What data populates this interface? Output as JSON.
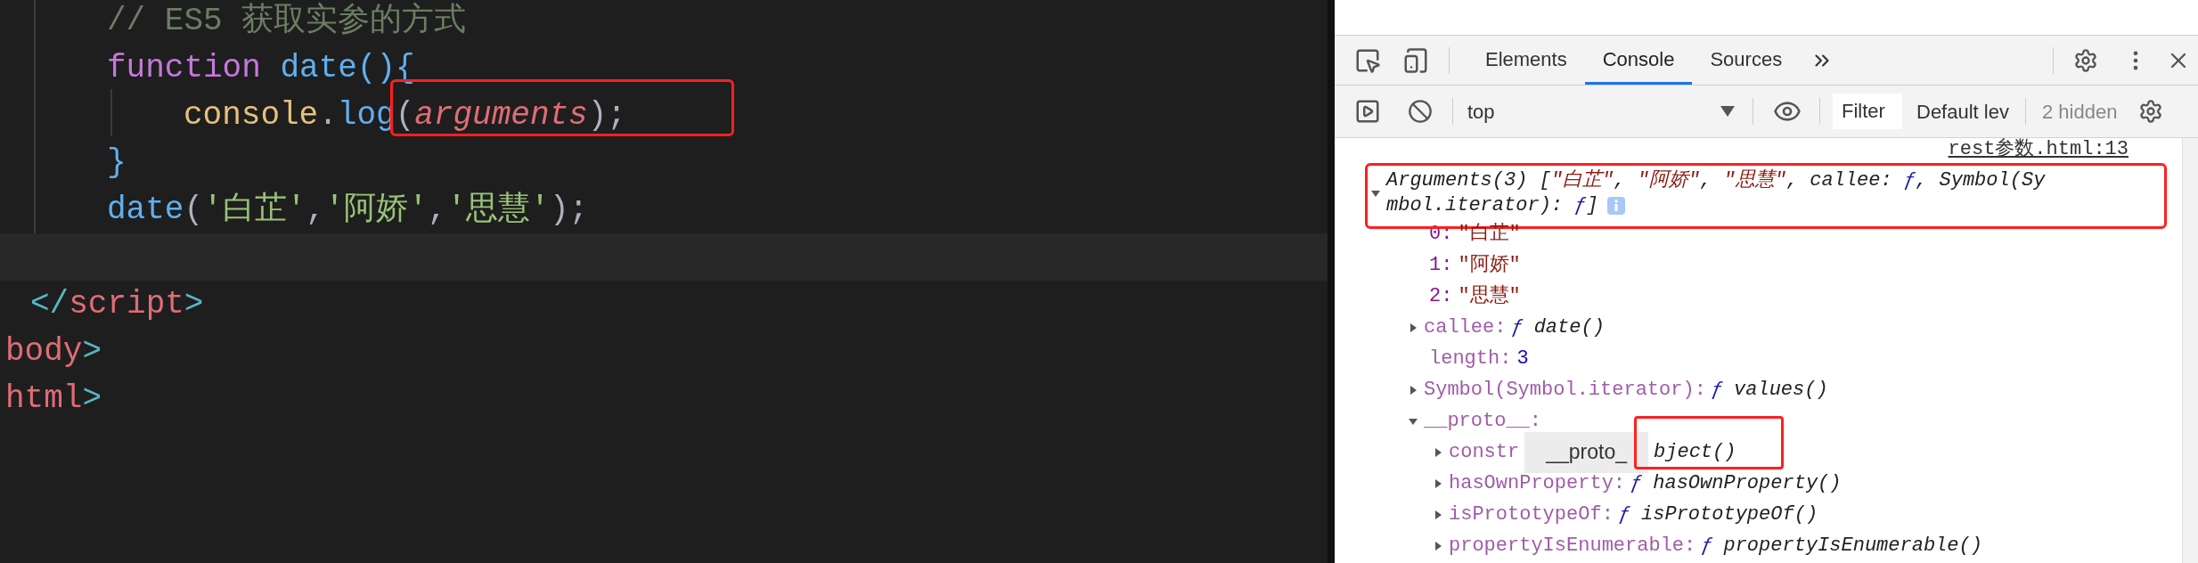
{
  "editor": {
    "script_lines": [
      {
        "kind": "code",
        "tokens": [
          {
            "t": "// ES5 获取实参的方式",
            "kind": "comment"
          }
        ]
      },
      {
        "kind": "code",
        "tokens": [
          {
            "t": "function ",
            "kind": "keyword"
          },
          {
            "t": "date",
            "kind": "fn"
          },
          {
            "t": "(){",
            "kind": "bracket"
          }
        ],
        "children": [
          {
            "kind": "code",
            "tokens": [
              {
                "t": "console",
                "kind": "var"
              },
              {
                "t": ".",
                "kind": "punct"
              },
              {
                "t": "log",
                "kind": "fn"
              }
            ],
            "boxed": [
              {
                "t": "(",
                "kind": "punct"
              },
              {
                "t": "arguments",
                "kind": "param"
              },
              {
                "t": ");",
                "kind": "punct"
              }
            ]
          }
        ]
      },
      {
        "kind": "code",
        "tokens": [
          {
            "t": "}",
            "kind": "bracket"
          }
        ]
      },
      {
        "kind": "code",
        "tokens": [
          {
            "t": "date",
            "kind": "fn"
          },
          {
            "t": "(",
            "kind": "punct"
          },
          {
            "t": "'白芷'",
            "kind": "string"
          },
          {
            "t": ",",
            "kind": "punct"
          },
          {
            "t": "'阿娇'",
            "kind": "string"
          },
          {
            "t": ",",
            "kind": "punct"
          },
          {
            "t": "'思慧'",
            "kind": "string"
          },
          {
            "t": ");",
            "kind": "punct"
          }
        ]
      },
      {
        "kind": "cursor-line"
      }
    ],
    "closing_tag": {
      "tokens": [
        {
          "t": "</",
          "kind": "tagbracket"
        },
        {
          "t": "script",
          "kind": "tag"
        },
        {
          "t": ">",
          "kind": "tagbracket"
        }
      ]
    },
    "outer_lines": [
      {
        "tokens": [
          {
            "t": "body",
            "kind": "tag"
          },
          {
            "t": ">",
            "kind": "tagbracket"
          }
        ]
      },
      {
        "tokens": [
          {
            "t": "html",
            "kind": "tag"
          },
          {
            "t": ">",
            "kind": "tagbracket"
          }
        ]
      }
    ]
  },
  "devtools": {
    "tabs": [
      {
        "label": "Elements",
        "selected": false
      },
      {
        "label": "Console",
        "selected": true
      },
      {
        "label": "Sources",
        "selected": false
      }
    ],
    "toolbar": {
      "context": "top",
      "filter_placeholder": "Filter",
      "levels": "Default lev",
      "hidden": "2 hidden"
    },
    "console": {
      "source": "rest参数.html:13",
      "entry": {
        "expanded": true,
        "highlighted": true,
        "summary_lines": [
          [
            {
              "t": "Arguments(3) [",
              "kind": "plain"
            },
            {
              "t": "\"白芷\"",
              "kind": "string"
            },
            {
              "t": ", ",
              "kind": "plain"
            },
            {
              "t": "\"阿娇\"",
              "kind": "string"
            },
            {
              "t": ", ",
              "kind": "plain"
            },
            {
              "t": "\"思慧\"",
              "kind": "string"
            },
            {
              "t": ", callee: ",
              "kind": "plain"
            },
            {
              "t": "ƒ",
              "kind": "func"
            },
            {
              "t": ", Symbol(Sy",
              "kind": "plain"
            }
          ],
          [
            {
              "t": "mbol.iterator): ",
              "kind": "plain"
            },
            {
              "t": "ƒ",
              "kind": "func"
            },
            {
              "t": "]",
              "kind": "plain"
            }
          ]
        ],
        "children": [
          {
            "kind": "leaf",
            "enumerable": true,
            "key": "0:",
            "value": [
              {
                "t": "\"白芷\"",
                "kind": "str"
              }
            ]
          },
          {
            "kind": "leaf",
            "enumerable": true,
            "key": "1:",
            "value": [
              {
                "t": "\"阿娇\"",
                "kind": "str"
              }
            ]
          },
          {
            "kind": "leaf",
            "enumerable": true,
            "key": "2:",
            "value": [
              {
                "t": "\"思慧\"",
                "kind": "str"
              }
            ]
          },
          {
            "kind": "node",
            "expanded": false,
            "enumerable": false,
            "key": "callee:",
            "value": [
              {
                "t": "ƒ",
                "kind": "func"
              },
              {
                "t": "date()",
                "kind": "italic"
              }
            ]
          },
          {
            "kind": "leaf",
            "enumerable": false,
            "key": "length:",
            "value": [
              {
                "t": "3",
                "kind": "number"
              }
            ]
          },
          {
            "kind": "node",
            "expanded": false,
            "enumerable": false,
            "key": "Symbol(Symbol.iterator):",
            "value": [
              {
                "t": "ƒ",
                "kind": "func"
              },
              {
                "t": "values()",
                "kind": "italic"
              }
            ]
          },
          {
            "kind": "node",
            "expanded": true,
            "enumerable": false,
            "key": "__proto__:",
            "children": [
              {
                "kind": "node",
                "expanded": false,
                "enumerable": false,
                "key": "constr",
                "tooltip": "__proto_",
                "highlighted": true,
                "value": [
                  {
                    "t": "bject()",
                    "kind": "italic"
                  }
                ]
              },
              {
                "kind": "node",
                "expanded": false,
                "enumerable": false,
                "key": "hasOwnProperty:",
                "value": [
                  {
                    "t": "ƒ",
                    "kind": "func"
                  },
                  {
                    "t": "hasOwnProperty()",
                    "kind": "italic"
                  }
                ]
              },
              {
                "kind": "node",
                "expanded": false,
                "enumerable": false,
                "key": "isPrototypeOf:",
                "value": [
                  {
                    "t": "ƒ",
                    "kind": "func"
                  },
                  {
                    "t": "isPrototypeOf()",
                    "kind": "italic"
                  }
                ]
              },
              {
                "kind": "node",
                "expanded": false,
                "enumerable": false,
                "key": "propertyIsEnumerable:",
                "value": [
                  {
                    "t": "ƒ",
                    "kind": "func"
                  },
                  {
                    "t": "propertyIsEnumerable()",
                    "kind": "italic"
                  }
                ]
              }
            ]
          }
        ]
      }
    }
  }
}
